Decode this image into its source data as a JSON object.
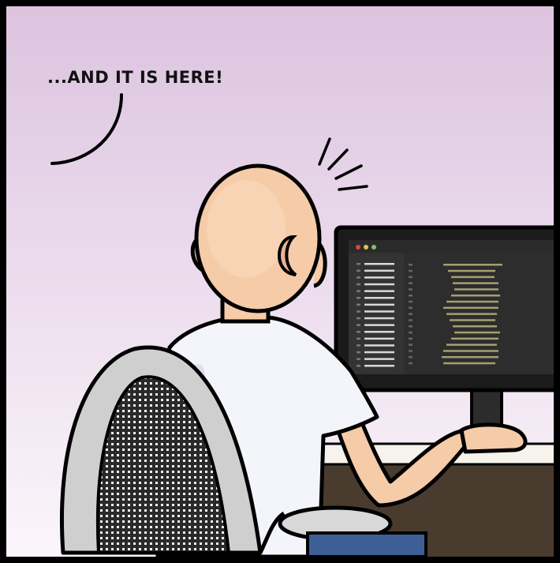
{
  "speech_text": "...AND IT IS HERE!",
  "colors": {
    "sky_top": "#dcc3df",
    "sky_bottom": "#fbf6fb",
    "border": "#000000",
    "skin": "#f5cba8",
    "skin_shade": "#e9b292",
    "shirt": "#f4f5fa",
    "chair": "#cfcfcf",
    "desk": "#4a3b2f",
    "monitor": "#1b1b1b",
    "code_line": "#a3a071",
    "pants": "#3d5f95"
  },
  "icons": [
    "speech-bubble-tail",
    "surprise-lines",
    "code-editor-screen",
    "window-controls"
  ]
}
